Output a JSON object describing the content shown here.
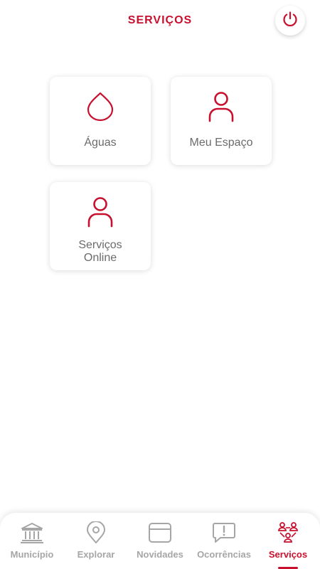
{
  "header": {
    "title": "SERVIÇOS",
    "power_icon": "power-icon"
  },
  "services": [
    {
      "label": "Águas",
      "icon": "water-drop-icon"
    },
    {
      "label": "Meu Espaço",
      "icon": "user-icon"
    },
    {
      "label_line1": "Serviços",
      "label_line2": "Online",
      "icon": "user-icon"
    }
  ],
  "bottom_nav": {
    "active": "Serviços",
    "items": [
      {
        "label": "Município",
        "icon": "municipality-icon"
      },
      {
        "label": "Explorar",
        "icon": "location-pin-icon"
      },
      {
        "label": "Novidades",
        "icon": "news-card-icon"
      },
      {
        "label": "Ocorrências",
        "icon": "alert-message-icon"
      },
      {
        "label": "Serviços",
        "icon": "services-network-icon"
      }
    ]
  },
  "colors": {
    "accent": "#c8102e",
    "inactive": "#a6a6a6",
    "label": "#6b6b6b",
    "background": "#ffffff"
  }
}
